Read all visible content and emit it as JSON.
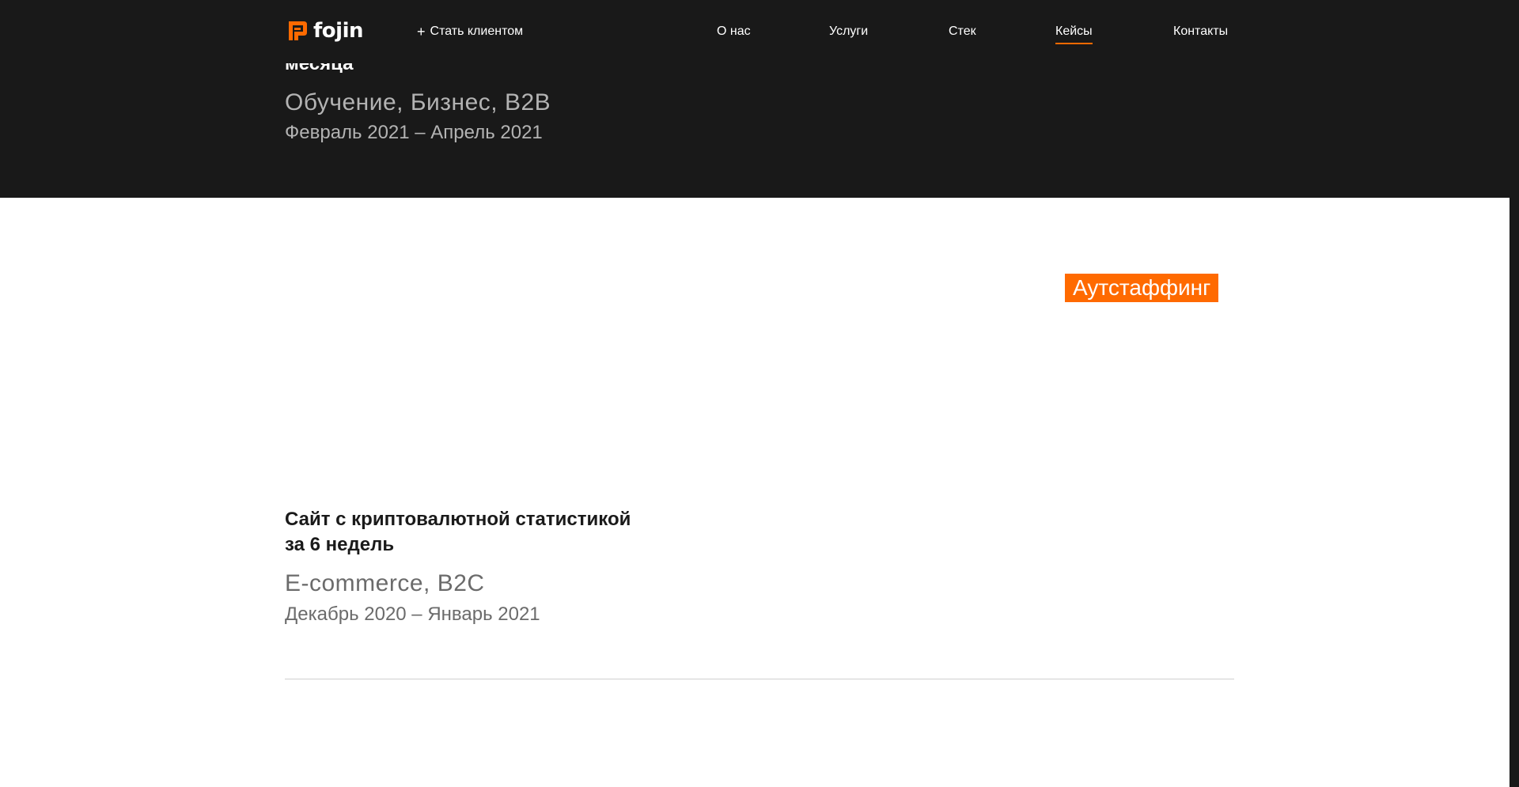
{
  "header": {
    "logo_text": "fojin",
    "become_client_plus": "+",
    "become_client_label": "Стать клиентом",
    "nav": [
      {
        "label": "О нас"
      },
      {
        "label": "Услуги"
      },
      {
        "label": "Стек"
      },
      {
        "label": "Кейсы",
        "active": true
      },
      {
        "label": "Контакты"
      }
    ]
  },
  "previous_case": {
    "title_fragment": "месяца",
    "tags": "Обучение, Бизнес, B2B",
    "dates": "Февраль 2021 – Апрель 2021"
  },
  "current_case": {
    "badge": "Аутстаффинг",
    "title": "Сайт с криптовалютной статистикой за 6 недель",
    "tags": "E-commerce, B2C",
    "dates": "Декабрь 2020 – Январь 2021"
  },
  "colors": {
    "accent": "#ff6a00",
    "dark_background": "#191919",
    "text_dark": "#1a1a1a",
    "text_muted": "#6b6b6b"
  }
}
